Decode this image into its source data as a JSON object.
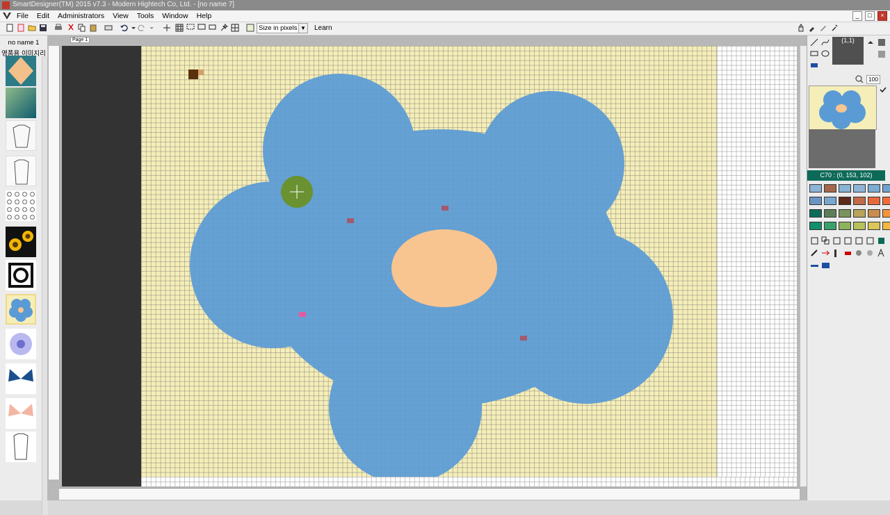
{
  "window": {
    "title": "SmartDesigner(TM) 2015 v7.3 - Modern Hightech Co, Ltd. - [no name 7]"
  },
  "menu": [
    "File",
    "Edit",
    "Administrators",
    "View",
    "Tools",
    "Window",
    "Help"
  ],
  "toolbar": {
    "size_select": "Size in pixels",
    "learn_label": "Learn"
  },
  "left_panel": {
    "file_name": "no name 1",
    "folder_label": "영품용 이미지리",
    "thumbnails": [
      {
        "name": "diamond-pattern-thumbnail"
      },
      {
        "name": "teal-gradient-thumbnail"
      },
      {
        "name": "jacket-sketch-thumbnail"
      },
      {
        "name": "shirt-sketch-thumbnail"
      },
      {
        "name": "circle-pattern-thumbnail"
      },
      {
        "name": "sunflower-thumbnail"
      },
      {
        "name": "geometric-pattern-thumbnail"
      },
      {
        "name": "blue-flower-thumbnail"
      },
      {
        "name": "purple-flower-thumbnail"
      },
      {
        "name": "blue-butterfly-thumbnail"
      },
      {
        "name": "pink-butterfly-thumbnail"
      },
      {
        "name": "coat-sketch-thumbnail"
      }
    ]
  },
  "editor": {
    "page_tab": "Page 1"
  },
  "right_panel": {
    "coordinate": "(1,1)",
    "zoom": "100",
    "color_readout": "C70 : (0, 153, 102)",
    "palette": [
      [
        "#8db4d6",
        "#a4674a",
        "#89b3d3",
        "#8eb5d8",
        "#7cabd4",
        "#6fa2d1"
      ],
      [
        "#6a95c2",
        "#7aa6cf",
        "#5b2a18",
        "#c26a4a",
        "#e76a3d",
        "#f16b3a"
      ],
      [
        "#0f6b57",
        "#5c7f58",
        "#79945b",
        "#b9a45a",
        "#c98d4f",
        "#f4943b"
      ],
      [
        "#0f8f6b",
        "#3aa16c",
        "#8db45a",
        "#b7c05a",
        "#dbc65a",
        "#f2b83f"
      ]
    ],
    "accent_color": "#0d6a58"
  },
  "canvas": {
    "background_color": "#f5eeb8",
    "flower_color": "#5a9bd6",
    "center_color": "#f8c48f"
  }
}
